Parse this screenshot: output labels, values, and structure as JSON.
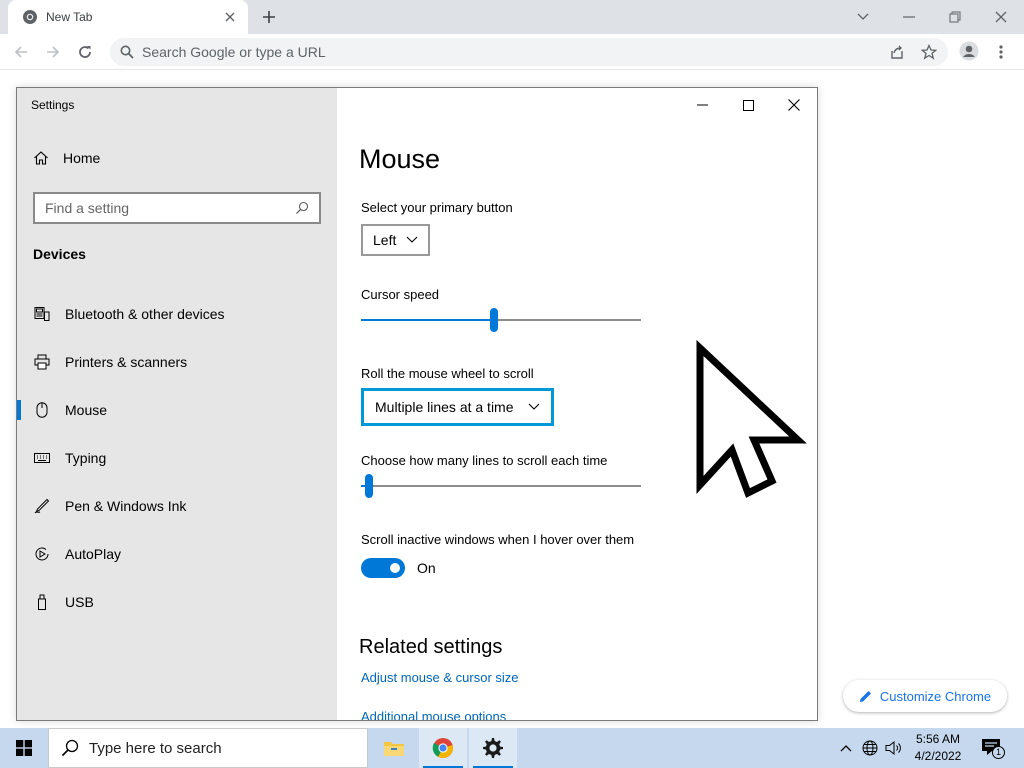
{
  "browser": {
    "tab_title": "New Tab",
    "omnibox_placeholder": "Search Google or type a URL",
    "customize_label": "Customize Chrome"
  },
  "settings": {
    "window_title": "Settings",
    "home_label": "Home",
    "search_placeholder": "Find a setting",
    "section_label": "Devices",
    "nav_items": [
      {
        "label": "Bluetooth & other devices",
        "icon": "bluetooth-devices-icon"
      },
      {
        "label": "Printers & scanners",
        "icon": "printer-icon"
      },
      {
        "label": "Mouse",
        "icon": "mouse-icon",
        "selected": true
      },
      {
        "label": "Typing",
        "icon": "keyboard-icon"
      },
      {
        "label": "Pen & Windows Ink",
        "icon": "pen-icon"
      },
      {
        "label": "AutoPlay",
        "icon": "autoplay-icon"
      },
      {
        "label": "USB",
        "icon": "usb-icon"
      }
    ],
    "page_title": "Mouse",
    "primary_button_label": "Select your primary button",
    "primary_button_value": "Left",
    "cursor_speed_label": "Cursor speed",
    "cursor_speed_value": 0.475,
    "wheel_label": "Roll the mouse wheel to scroll",
    "wheel_value": "Multiple lines at a time",
    "lines_label": "Choose how many lines to scroll each time",
    "lines_value": 0.03,
    "inactive_label": "Scroll inactive windows when I hover over them",
    "inactive_state": "On",
    "related_heading": "Related settings",
    "link_adjust": "Adjust mouse & cursor size",
    "link_additional": "Additional mouse options"
  },
  "taskbar": {
    "search_placeholder": "Type here to search",
    "time": "5:56 AM",
    "date": "4/2/2022",
    "notification_count": "1"
  },
  "colors": {
    "accent": "#0078d7",
    "focus": "#0099d8",
    "link": "#0067b8",
    "taskbar": "#c5d8ee"
  }
}
